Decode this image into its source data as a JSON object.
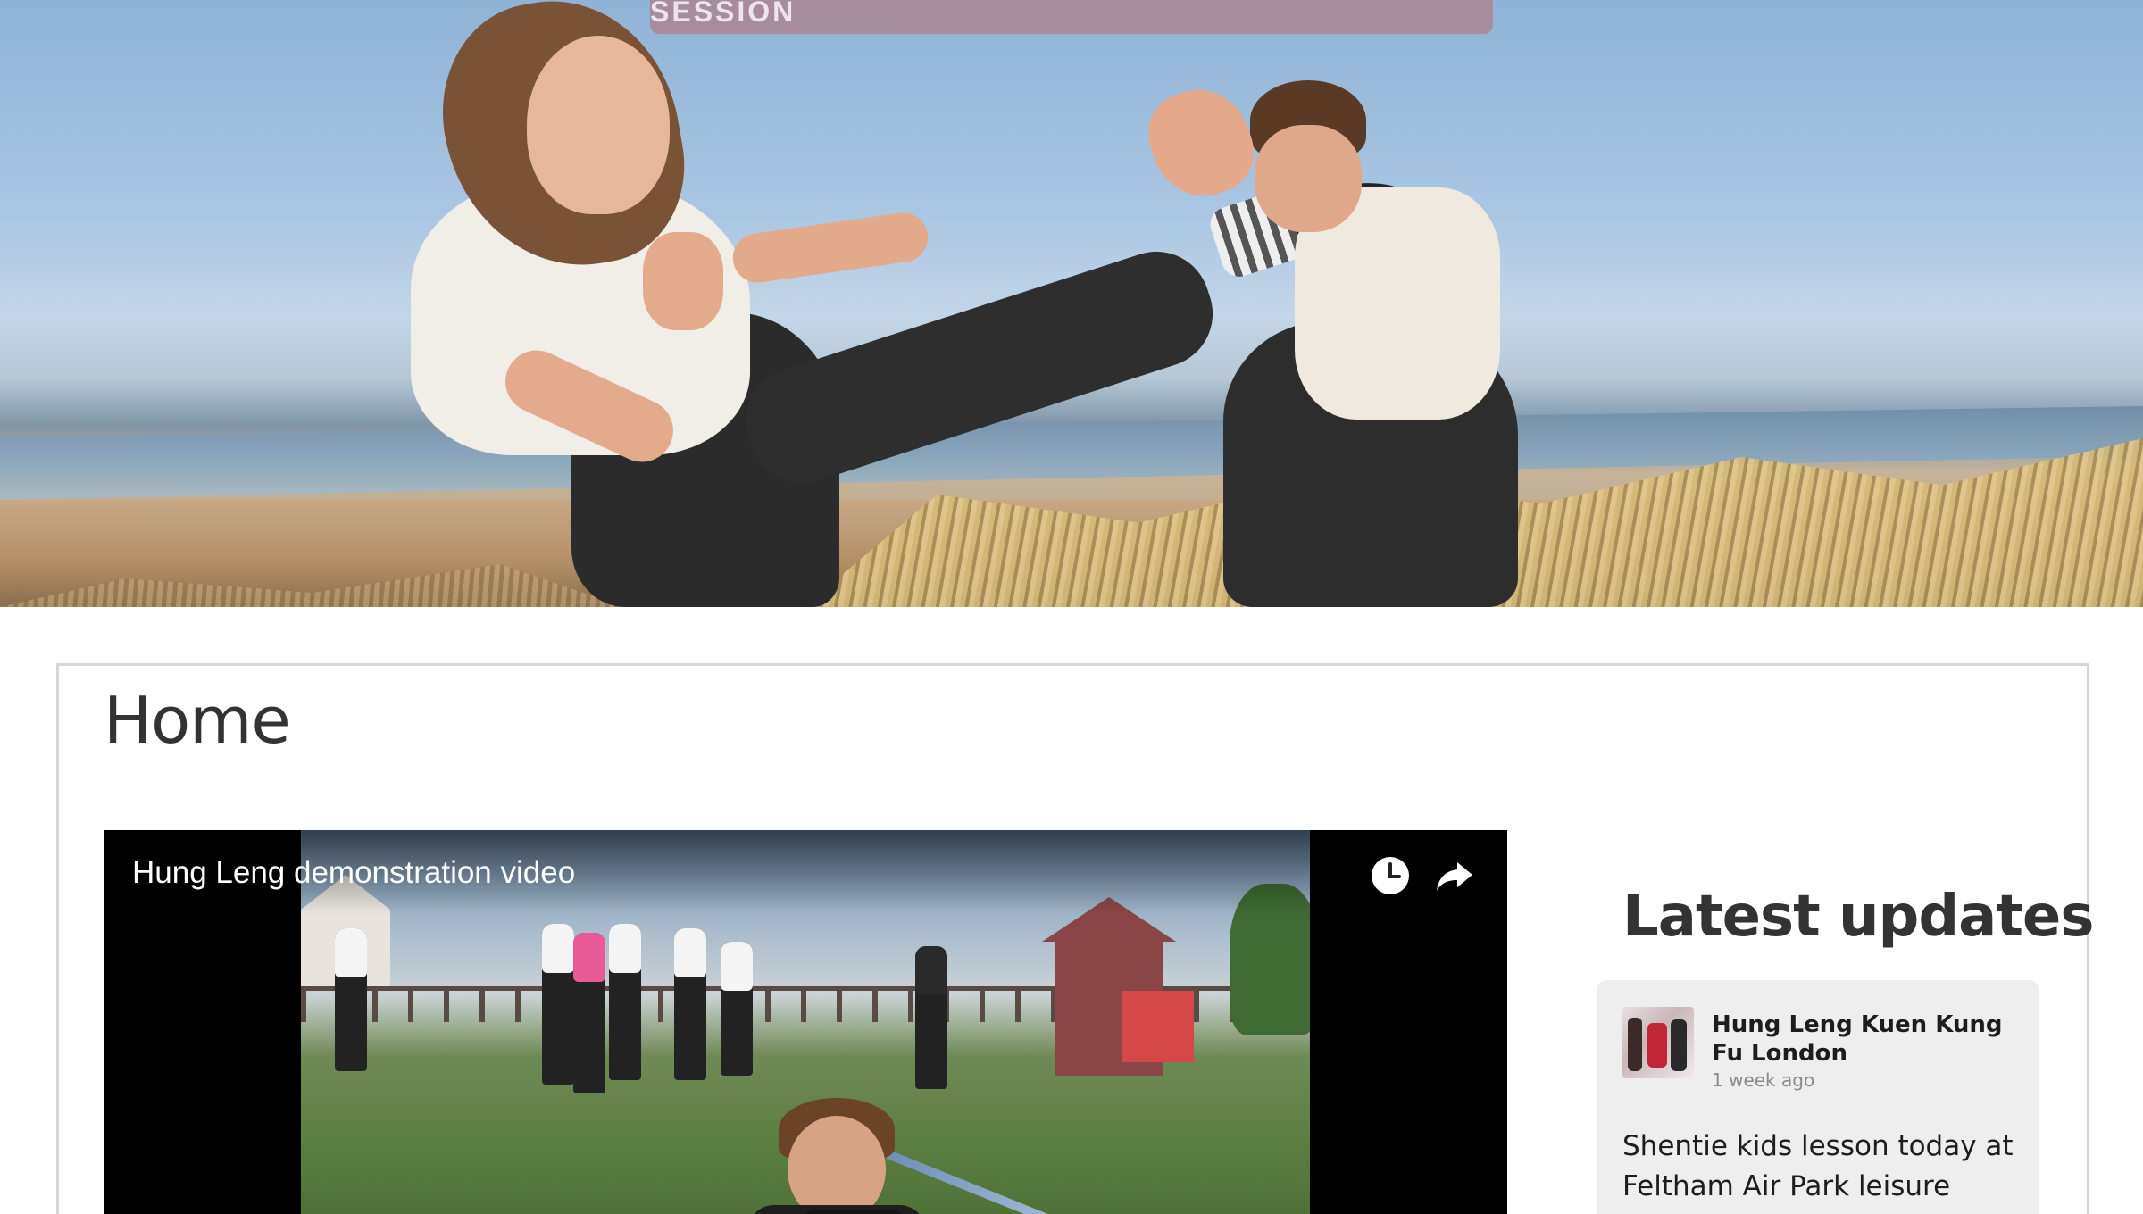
{
  "hero": {
    "cta_label": "START TRAINING WITH YOUR FREE TASTER SESSION"
  },
  "page": {
    "title": "Home"
  },
  "video": {
    "title": "Hung Leng demonstration video",
    "icons": [
      "clock-icon",
      "share-icon",
      "play-icon"
    ]
  },
  "sidebar": {
    "title": "Latest updates",
    "update": {
      "author": "Hung Leng Kuen Kung Fu London",
      "time": "1 week ago",
      "text": "Shentie kids lesson today at Feltham Air Park leisure centre"
    }
  },
  "colors": {
    "cta_background": "#a98a9a",
    "card_background": "#eeeeee",
    "heading_text": "#333333",
    "border": "#d6d6d6"
  }
}
